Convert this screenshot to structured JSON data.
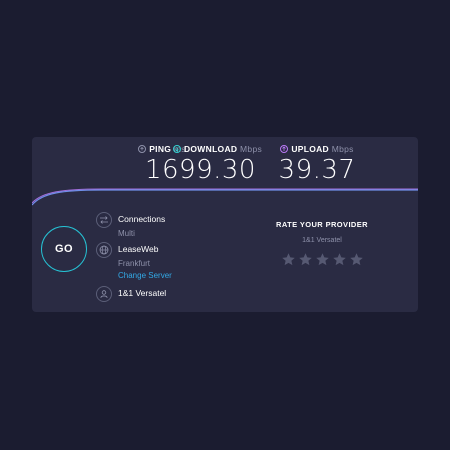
{
  "metrics": {
    "ping": {
      "label": "PING",
      "unit": "ms",
      "value": "16"
    },
    "download": {
      "label": "DOWNLOAD",
      "unit": "Mbps",
      "value": "99.30"
    },
    "upload": {
      "label": "UPLOAD",
      "unit": "Mbps",
      "value": "39.37"
    }
  },
  "go_button": {
    "label": "GO"
  },
  "connections": {
    "title": "Connections",
    "mode": "Multi"
  },
  "server": {
    "host": "LeaseWeb",
    "location": "Frankfurt",
    "change_label": "Change Server"
  },
  "isp": {
    "name": "1&1 Versatel"
  },
  "rating": {
    "title": "RATE YOUR PROVIDER",
    "provider": "1&1 Versatel",
    "stars_total": 5,
    "stars_selected": 0
  },
  "colors": {
    "background": "#1b1c30",
    "card": "#2a2b43",
    "download_accent": "#34d0d0",
    "upload_accent": "#b979f5",
    "go_ring": "#26c2d4",
    "link": "#33a9e6",
    "star": "#565972"
  }
}
